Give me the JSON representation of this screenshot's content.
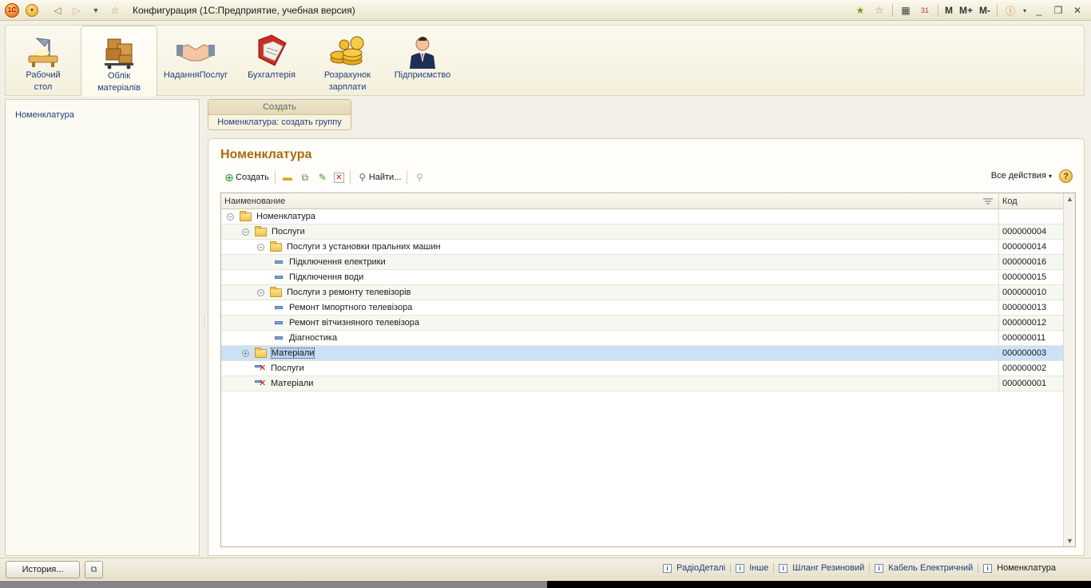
{
  "titlebar": {
    "title": "Конфигурация  (1С:Предприятие, учебная версия)",
    "logo_text": "1С",
    "m_labels": [
      "M",
      "M+",
      "M-"
    ]
  },
  "sections": [
    {
      "label_line1": "Рабочий",
      "label_line2": "стол",
      "icon": "desk-lamp-icon",
      "active": false
    },
    {
      "label_line1": "Облік",
      "label_line2": "матеріалів",
      "icon": "boxes-cart-icon",
      "active": true
    },
    {
      "label_line1": "НаданняПослуг",
      "label_line2": "",
      "icon": "handshake-icon",
      "active": false
    },
    {
      "label_line1": "Бухгалтерія",
      "label_line2": "",
      "icon": "ledger-book-icon",
      "active": false
    },
    {
      "label_line1": "Розрахунок",
      "label_line2": "зарплати",
      "icon": "coins-icon",
      "active": false
    },
    {
      "label_line1": "Підприємство",
      "label_line2": "",
      "icon": "businessman-icon",
      "active": false
    }
  ],
  "leftpanel": {
    "item": "Номенклатура"
  },
  "create_popup": {
    "header": "Создать",
    "item": "Номенклатура: создать группу"
  },
  "form": {
    "title": "Номенклатура",
    "cmd_create": "Создать",
    "cmd_find": "Найти...",
    "all_actions": "Все действия",
    "help": "?"
  },
  "table": {
    "col_name": "Наименование",
    "col_code": "Код",
    "rows": [
      {
        "name": "Номенклатура",
        "code": "",
        "kind": "folder",
        "level": 0,
        "expander": "⊖"
      },
      {
        "name": "Послуги",
        "code": "000000004",
        "kind": "folder",
        "level": 1,
        "expander": "⊖"
      },
      {
        "name": "Послуги з установки пральних машин",
        "code": "000000014",
        "kind": "folder",
        "level": 2,
        "expander": "⊖"
      },
      {
        "name": "Підключення електрики",
        "code": "000000016",
        "kind": "item",
        "level": 3,
        "expander": ""
      },
      {
        "name": "Підключення води",
        "code": "000000015",
        "kind": "item",
        "level": 3,
        "expander": ""
      },
      {
        "name": "Послуги з ремонту телевізорів",
        "code": "000000010",
        "kind": "folder",
        "level": 2,
        "expander": "⊖"
      },
      {
        "name": "Ремонт Імпортного телевізора",
        "code": "000000013",
        "kind": "item",
        "level": 3,
        "expander": ""
      },
      {
        "name": "Ремонт вітчизняного телевізора",
        "code": "000000012",
        "kind": "item",
        "level": 3,
        "expander": ""
      },
      {
        "name": "Діагностика",
        "code": "000000011",
        "kind": "item",
        "level": 3,
        "expander": ""
      },
      {
        "name": "Матеріали",
        "code": "000000003",
        "kind": "folder",
        "level": 1,
        "expander": "⊕",
        "selected": true
      },
      {
        "name": "Послуги",
        "code": "000000002",
        "kind": "deleted",
        "level": 1,
        "expander": ""
      },
      {
        "name": "Матеріали",
        "code": "000000001",
        "kind": "deleted",
        "level": 1,
        "expander": ""
      }
    ]
  },
  "statusbar": {
    "history_button": "История...",
    "open_windows": [
      "РадіоДеталі",
      "Інше",
      "Шланг Резиновий",
      "Кабель Електричний",
      "Номенклатура"
    ]
  }
}
